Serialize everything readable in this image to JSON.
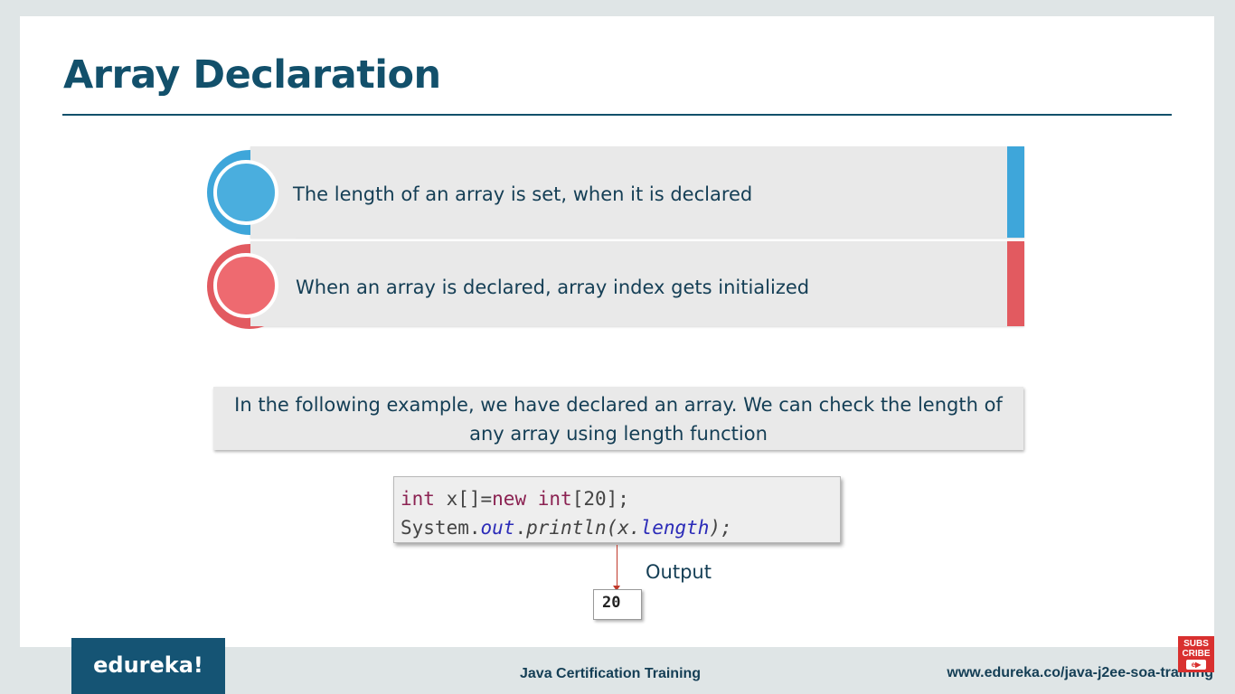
{
  "slide": {
    "title": "Array Declaration",
    "bullets": [
      {
        "text": "The length of an array is set, when it is declared",
        "color": "#3ea6da"
      },
      {
        "text": "When an array is declared, array index gets initialized",
        "color": "#e25a60"
      }
    ],
    "info": {
      "line1": "In the following example, we have declared an array. We can check the length of",
      "line2": "any array using length function"
    },
    "code": {
      "line1": {
        "kw": "int",
        "rest1": " x[]=",
        "kw2": "new",
        "sp": " ",
        "kw3": "int",
        "rest2": "[20];"
      },
      "line2": {
        "pre": "System.",
        "fld1": "out",
        "dot": ".",
        "meth": "println(x.",
        "fld2": "length",
        "end": ");"
      }
    },
    "output": {
      "label": "Output",
      "value": "20"
    }
  },
  "footer": {
    "logo": "edureka!",
    "course": "Java Certification Training",
    "url": "www.edureka.co/java-j2ee-soa-training",
    "subscribe_line1": "SUBS",
    "subscribe_line2": "CRIBE",
    "subscribe_play": "e▶"
  },
  "colors": {
    "title": "#12506b",
    "blue_accent": "#3ea6da",
    "red_accent": "#e25a60",
    "logo_bg": "#155474",
    "subscribe_bg": "#d9302f"
  }
}
